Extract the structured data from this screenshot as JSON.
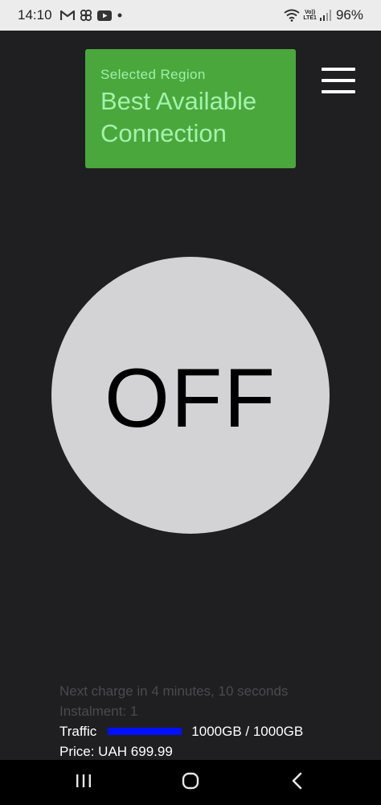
{
  "status_bar": {
    "time": "14:10",
    "notification_icons": [
      "gmail-icon",
      "pinwheel-icon",
      "youtube-icon",
      "dot-icon"
    ],
    "volte_label_top": "Vo))",
    "volte_label_bottom": "LTE1",
    "battery": "96%"
  },
  "region": {
    "label": "Selected Region",
    "value_line1": "Best Available",
    "value_line2": "Connection",
    "background_color": "#4aa73c"
  },
  "power": {
    "state_label": "OFF",
    "circle_color": "#d3d2d4"
  },
  "info": {
    "next_charge": "Next charge in 4 minutes, 10 seconds",
    "instalment": "Instalment: 1",
    "traffic_label": "Traffic",
    "traffic_value": "1000GB / 1000GB",
    "traffic_fraction": 1.0,
    "traffic_bar_color": "#0010ff",
    "price": "Price: UAH 699.99"
  },
  "nav": {
    "recents": "recents-icon",
    "home": "home-icon",
    "back": "back-icon"
  }
}
